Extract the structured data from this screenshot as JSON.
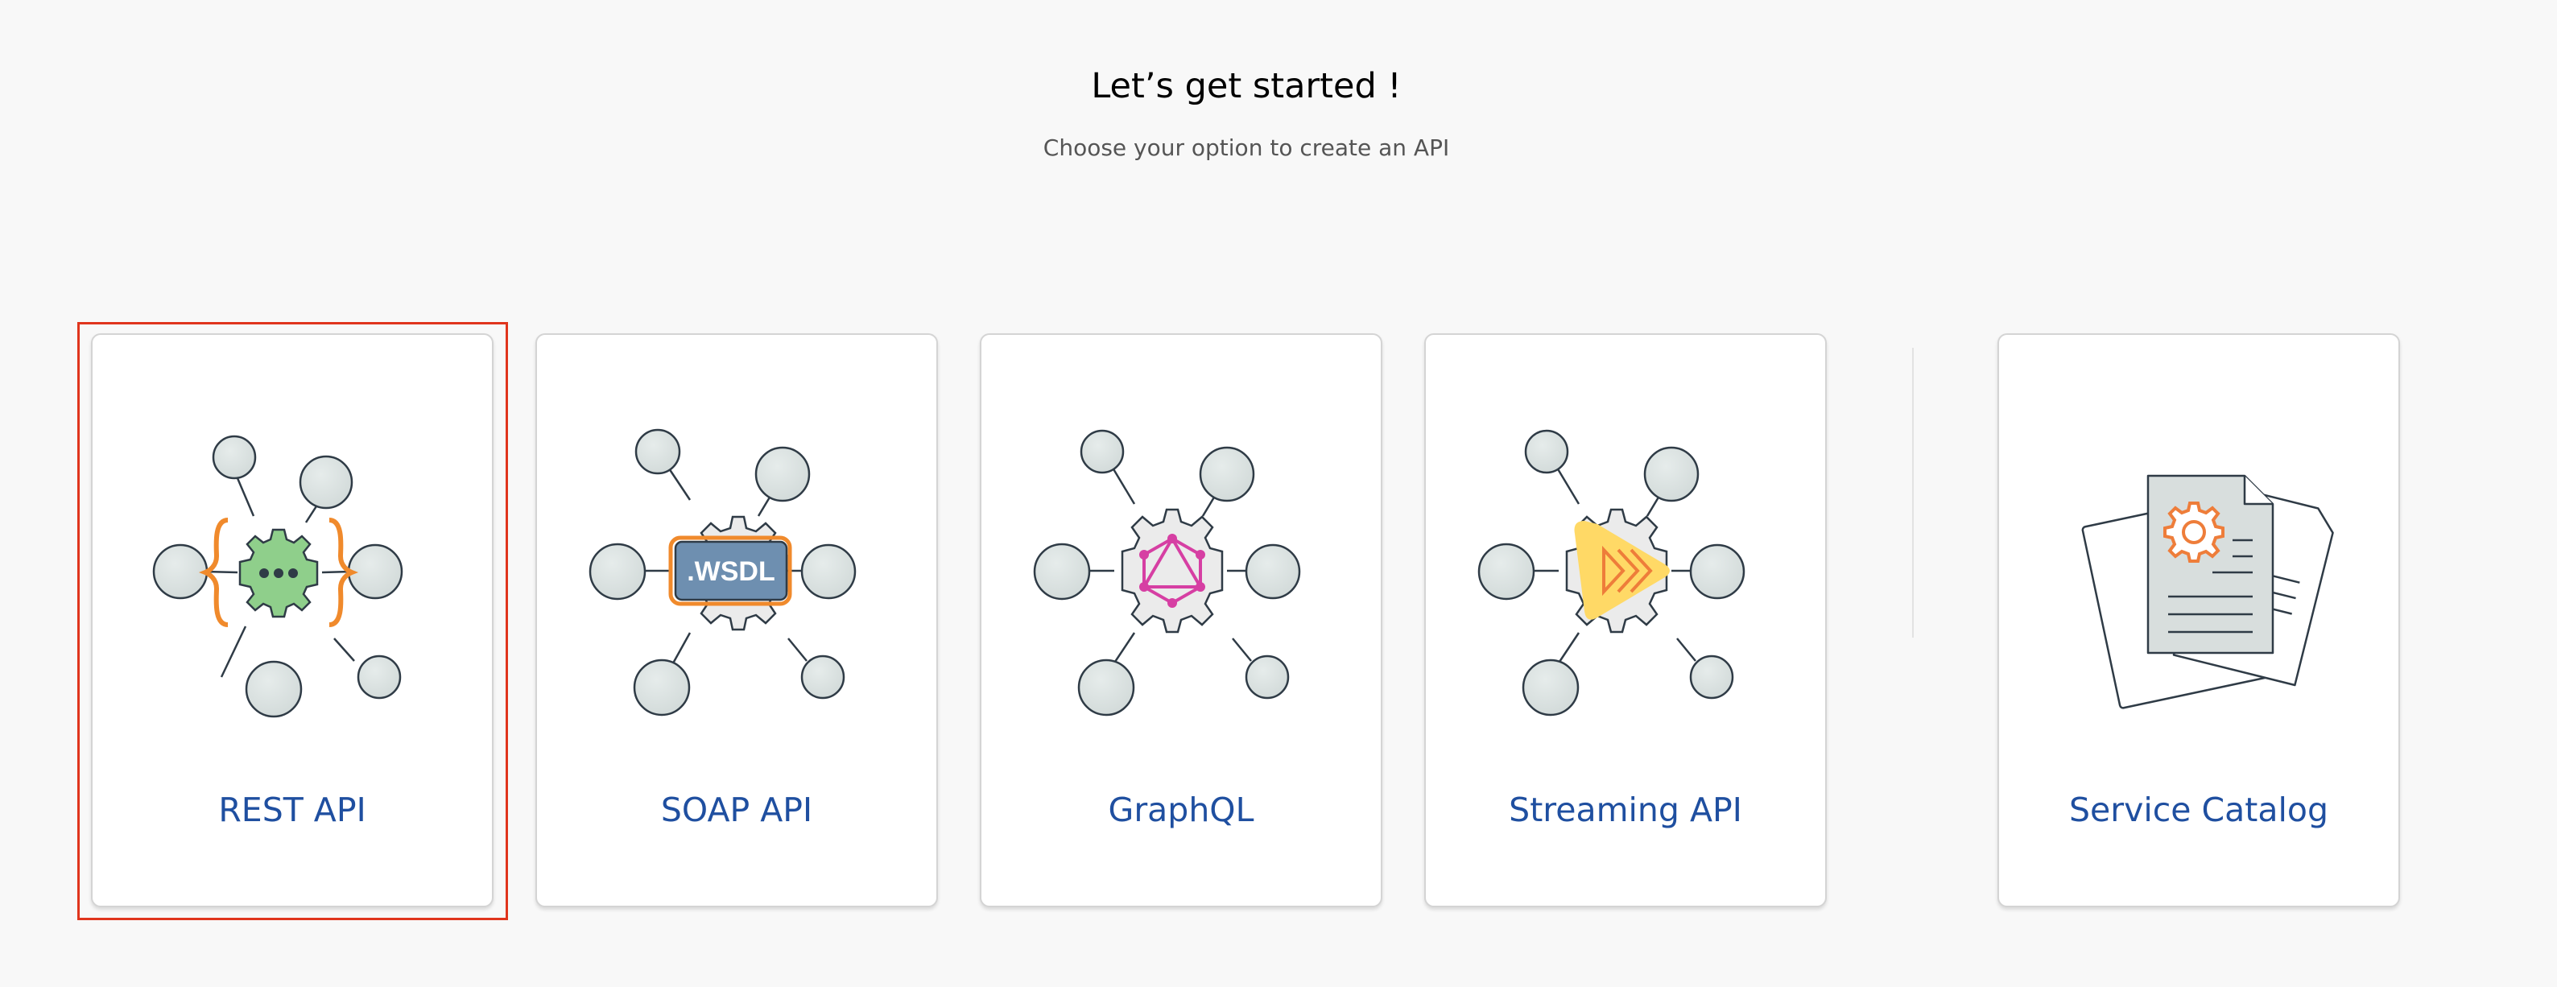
{
  "header": {
    "title": "Let’s get started !",
    "subtitle": "Choose your option to create an API"
  },
  "options": [
    {
      "label": "REST API",
      "icon": "rest-api-icon",
      "selected": true
    },
    {
      "label": "SOAP API",
      "icon": "soap-api-icon",
      "badge": ".WSDL"
    },
    {
      "label": "GraphQL",
      "icon": "graphql-icon"
    },
    {
      "label": "Streaming API",
      "icon": "streaming-api-icon"
    },
    {
      "label": "Service Catalog",
      "icon": "service-catalog-icon"
    }
  ],
  "colors": {
    "label": "#1f4fa0",
    "selection": "#e0351d",
    "rest_gear": "#8fcf8b",
    "rest_braces": "#f08a2c",
    "wsdl_badge": "#6e8fb0",
    "graphql": "#d63fa3",
    "streaming": "#ffd966",
    "streaming_arrows": "#ee7d3a",
    "node_fill": "#d8dedd"
  }
}
